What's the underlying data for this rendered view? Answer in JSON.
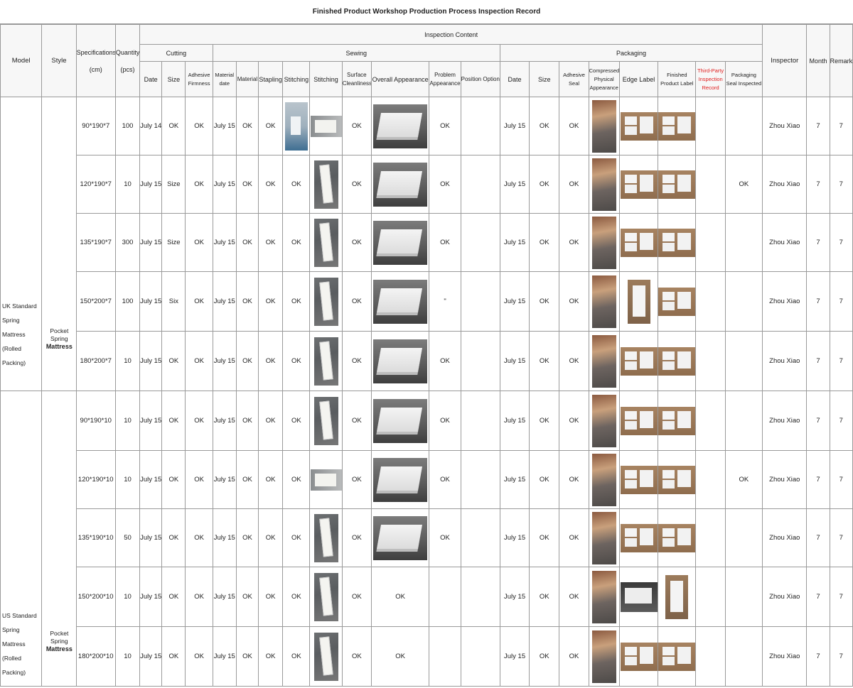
{
  "title": "Finished Product Workshop Production Process Inspection Record",
  "headers": {
    "model": "Model",
    "style": "Style",
    "specifications": "Specifications",
    "spec_unit": "(cm)",
    "quantity": "Quantity",
    "qty_unit": "(pcs)",
    "inspection_content": "Inspection Content",
    "cutting": "Cutting",
    "sewing": "Sewing",
    "packaging": "Packaging",
    "inspector": "Inspector",
    "month": "Month",
    "remarks": "Remarks",
    "cut_date": "Date",
    "cut_size": "Size",
    "cut_adhesive": "Adhesive Firmness",
    "sew_material_date": "Material date",
    "sew_material": "Material",
    "sew_stapling": "Stapling",
    "sew_stitching1": "Stitching",
    "sew_stitching2": "Stitching",
    "sew_surface": "Surface Cleanliness",
    "sew_overall": "Overall Appearance",
    "sew_problem": "Problem Appearance",
    "sew_position": "Position Option",
    "pack_date": "Date",
    "pack_size": "Size",
    "pack_adhesive": "Adhesive Seal",
    "pack_compressed": "Compressed Physical Appearance",
    "pack_edge": "Edge Label",
    "pack_finished": "Finished Product Label",
    "pack_third": "Third-Party Inspection Record",
    "pack_seal": "Packaging Seal Inspected"
  },
  "groups": [
    {
      "model": "UK Standard",
      "model_sub": "Spring Mattress",
      "model_sub2": "(Rolled Packing)",
      "style_line1": "Pocket Spring",
      "style_line2": "Mattress"
    },
    {
      "model": "US Standard",
      "model_sub": "Spring Mattress",
      "model_sub2": "(Rolled Packing)",
      "style_line1": "Pocket Spring",
      "style_line2": "Mattress"
    }
  ],
  "rows": [
    {
      "spec": "90*190*7",
      "qty": "100",
      "cut_date": "July 14",
      "cut_size": "OK",
      "cut_adh": "OK",
      "sew_date": "July 15",
      "material": "OK",
      "stapling": "OK",
      "stitching": "",
      "surface": "OK",
      "overall": "",
      "problem": "OK",
      "position": "",
      "pack_date": "July 15",
      "pack_size": "OK",
      "pack_adh": "OK",
      "third": "",
      "seal": "",
      "inspector": "Zhou Xiao",
      "month": "7",
      "remarks": "7"
    },
    {
      "spec": "120*190*7",
      "qty": "10",
      "cut_date": "July 15",
      "cut_size": "Size",
      "cut_adh": "OK",
      "sew_date": "July 15",
      "material": "OK",
      "stapling": "OK",
      "stitching": "OK",
      "surface": "OK",
      "overall": "",
      "problem": "OK",
      "position": "",
      "pack_date": "July 15",
      "pack_size": "OK",
      "pack_adh": "OK",
      "third": "",
      "seal": "OK",
      "inspector": "Zhou Xiao",
      "month": "7",
      "remarks": "7"
    },
    {
      "spec": "135*190*7",
      "qty": "300",
      "cut_date": "July 15",
      "cut_size": "Size",
      "cut_adh": "OK",
      "sew_date": "July 15",
      "material": "OK",
      "stapling": "OK",
      "stitching": "OK",
      "surface": "OK",
      "overall": "",
      "problem": "OK",
      "position": "",
      "pack_date": "July 15",
      "pack_size": "OK",
      "pack_adh": "OK",
      "third": "",
      "seal": "",
      "inspector": "Zhou Xiao",
      "month": "7",
      "remarks": "7"
    },
    {
      "spec": "150*200*7",
      "qty": "100",
      "cut_date": "July 15",
      "cut_size": "Six",
      "cut_adh": "OK",
      "sew_date": "July 15",
      "material": "OK",
      "stapling": "OK",
      "stitching": "OK",
      "surface": "OK",
      "overall": "",
      "problem": "\"",
      "position": "",
      "pack_date": "July 15",
      "pack_size": "OK",
      "pack_adh": "OK",
      "third": "",
      "seal": "",
      "inspector": "Zhou Xiao",
      "month": "7",
      "remarks": "7"
    },
    {
      "spec": "180*200*7",
      "qty": "10",
      "cut_date": "July 15",
      "cut_size": "OK",
      "cut_adh": "OK",
      "sew_date": "July 15",
      "material": "OK",
      "stapling": "OK",
      "stitching": "OK",
      "surface": "OK",
      "overall": "",
      "problem": "OK",
      "position": "",
      "pack_date": "July 15",
      "pack_size": "OK",
      "pack_adh": "OK",
      "third": "",
      "seal": "",
      "inspector": "Zhou Xiao",
      "month": "7",
      "remarks": "7"
    },
    {
      "spec": "90*190*10",
      "qty": "10",
      "cut_date": "July 15",
      "cut_size": "OK",
      "cut_adh": "OK",
      "sew_date": "July 15",
      "material": "OK",
      "stapling": "OK",
      "stitching": "OK",
      "surface": "OK",
      "overall": "",
      "problem": "OK",
      "position": "",
      "pack_date": "July 15",
      "pack_size": "OK",
      "pack_adh": "OK",
      "third": "",
      "seal": "",
      "inspector": "Zhou Xiao",
      "month": "7",
      "remarks": "7"
    },
    {
      "spec": "120*190*10",
      "qty": "10",
      "cut_date": "July 15",
      "cut_size": "OK",
      "cut_adh": "OK",
      "sew_date": "July 15",
      "material": "OK",
      "stapling": "OK",
      "stitching": "OK",
      "surface": "OK",
      "overall": "",
      "problem": "OK",
      "position": "",
      "pack_date": "July 15",
      "pack_size": "OK",
      "pack_adh": "OK",
      "third": "",
      "seal": "OK",
      "inspector": "Zhou Xiao",
      "month": "7",
      "remarks": "7"
    },
    {
      "spec": "135*190*10",
      "qty": "50",
      "cut_date": "July 15",
      "cut_size": "OK",
      "cut_adh": "OK",
      "sew_date": "July 15",
      "material": "OK",
      "stapling": "OK",
      "stitching": "OK",
      "surface": "OK",
      "overall": "",
      "problem": "OK",
      "position": "",
      "pack_date": "July 15",
      "pack_size": "OK",
      "pack_adh": "OK",
      "third": "",
      "seal": "",
      "inspector": "Zhou Xiao",
      "month": "7",
      "remarks": "7"
    },
    {
      "spec": "150*200*10",
      "qty": "10",
      "cut_date": "July 15",
      "cut_size": "OK",
      "cut_adh": "OK",
      "sew_date": "July 15",
      "material": "OK",
      "stapling": "OK",
      "stitching": "OK",
      "surface": "OK",
      "overall": "OK",
      "problem": "",
      "position": "",
      "pack_date": "July 15",
      "pack_size": "OK",
      "pack_adh": "OK",
      "third": "",
      "seal": "",
      "inspector": "Zhou Xiao",
      "month": "7",
      "remarks": "7"
    },
    {
      "spec": "180*200*10",
      "qty": "10",
      "cut_date": "July 15",
      "cut_size": "OK",
      "cut_adh": "OK",
      "sew_date": "July 15",
      "material": "OK",
      "stapling": "OK",
      "stitching": "OK",
      "surface": "OK",
      "overall": "OK",
      "problem": "",
      "position": "",
      "pack_date": "July 15",
      "pack_size": "OK",
      "pack_adh": "OK",
      "third": "",
      "seal": "",
      "inspector": "Zhou Xiao",
      "month": "7",
      "remarks": "7"
    }
  ]
}
